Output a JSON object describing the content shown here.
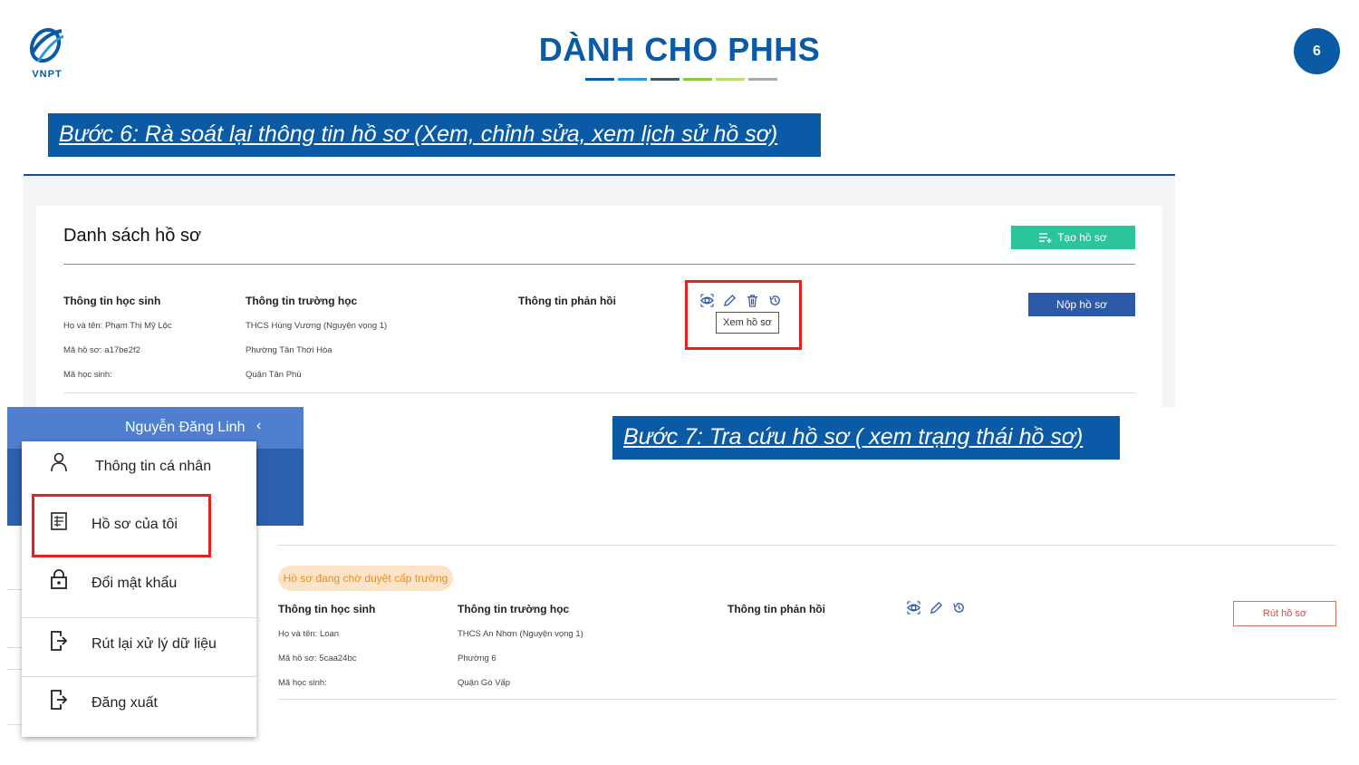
{
  "slide": {
    "logo_text": "VNPT",
    "title": "DÀNH CHO PHHS",
    "page_number": "6",
    "title_bar_colors": [
      "#0b5aa6",
      "#2a9ad6",
      "#4a5560",
      "#8cc63f",
      "#b9de6a",
      "#aaaaaa"
    ],
    "step6": "Bước 6: Rà soát lại thông tin hồ sơ (Xem, chỉnh sửa, xem lịch sử hồ sơ)",
    "step7": "Bước 7: Tra cứu hồ sơ ( xem trạng thái hồ sơ)"
  },
  "screen1": {
    "list_title": "Danh sách hồ sơ",
    "create_button": "Tạo hồ sơ",
    "headers": {
      "student": "Thông tin học sinh",
      "school": "Thông tin trường học",
      "feedback": "Thông tin phản hồi"
    },
    "student": [
      "Họ và tên: Phạm Thị Mỹ Lộc",
      "Mã hồ sơ: a17be2f2",
      "Mã học sinh:"
    ],
    "school": [
      "THCS Hùng Vương (Nguyện vọng 1)",
      "Phường Tân Thới Hòa",
      "Quận Tân Phú"
    ],
    "tooltip": "Xem hồ sơ",
    "submit_button": "Nộp hồ sơ",
    "icons": [
      "eye-icon",
      "pencil-icon",
      "trash-icon",
      "history-icon"
    ]
  },
  "menu": {
    "user_name": "Nguyễn Đăng Linh",
    "chevron": "‹",
    "items": [
      {
        "label": "Thông tin cá nhân",
        "icon": "user-icon"
      },
      {
        "label": "Hồ sơ của tôi",
        "icon": "document-icon"
      },
      {
        "label": "Đổi mật khẩu",
        "icon": "lock-icon"
      },
      {
        "label": "Rút lại xử lý dữ liệu",
        "icon": "exit-icon"
      },
      {
        "label": "Đăng xuất",
        "icon": "logout-icon"
      }
    ]
  },
  "screen2": {
    "status": "Hồ sơ đang chờ duyệt cấp trường",
    "headers": {
      "student": "Thông tin học sinh",
      "school": "Thông tin trường học",
      "feedback": "Thông tin phản hồi"
    },
    "student": [
      "Họ và tên: Loan",
      "Mã hồ sơ: 5caa24bc",
      "Mã học sinh:"
    ],
    "school": [
      "THCS An Nhơn (Nguyện vọng 1)",
      "Phường 6",
      "Quận Gò Vấp"
    ],
    "withdraw_button": "Rút hồ sơ",
    "icons": [
      "eye-icon",
      "pencil-icon",
      "history-icon"
    ]
  }
}
